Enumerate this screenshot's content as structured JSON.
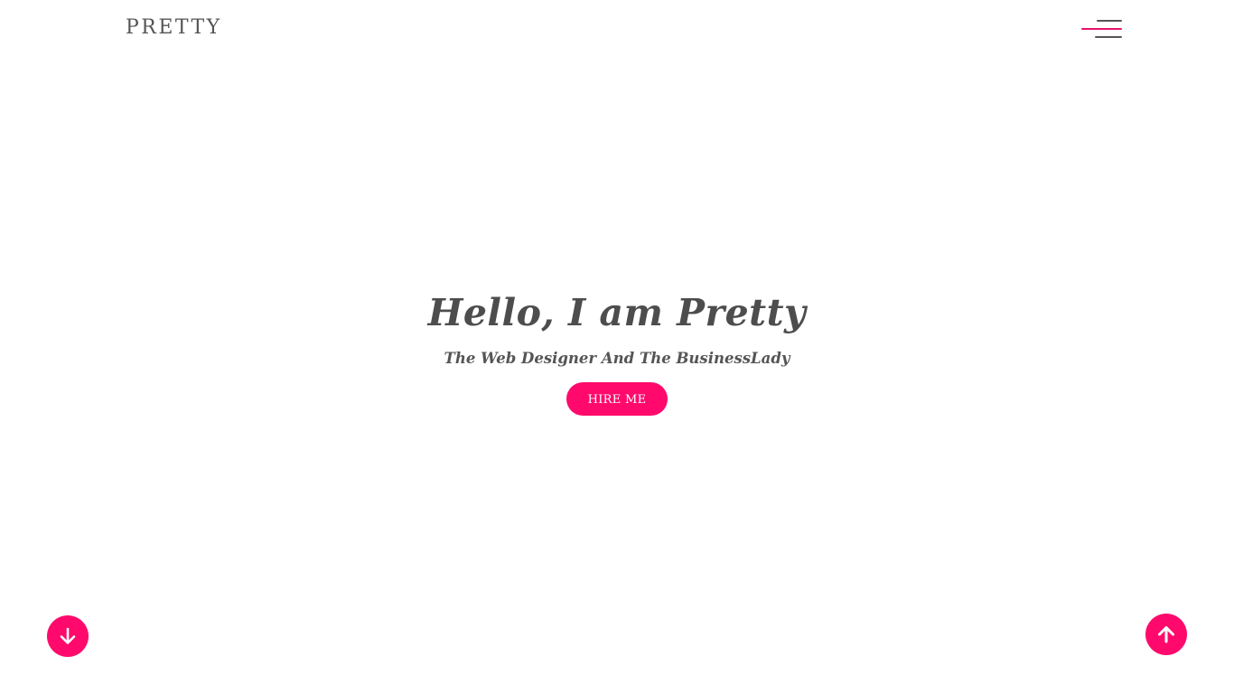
{
  "header": {
    "logo_text": "PRETTY",
    "menu_icon": "hamburger-menu-icon"
  },
  "hero": {
    "title": "Hello, I am Pretty",
    "subtitle": "The Web Designer And The BusinessLady",
    "cta_label": "HIRE ME"
  },
  "floating_buttons": {
    "scroll_down_icon": "arrow-down-icon",
    "scroll_up_icon": "arrow-up-icon"
  },
  "colors": {
    "accent": "#ff0a6c",
    "text": "#4d4d4d",
    "background": "#ffffff"
  }
}
